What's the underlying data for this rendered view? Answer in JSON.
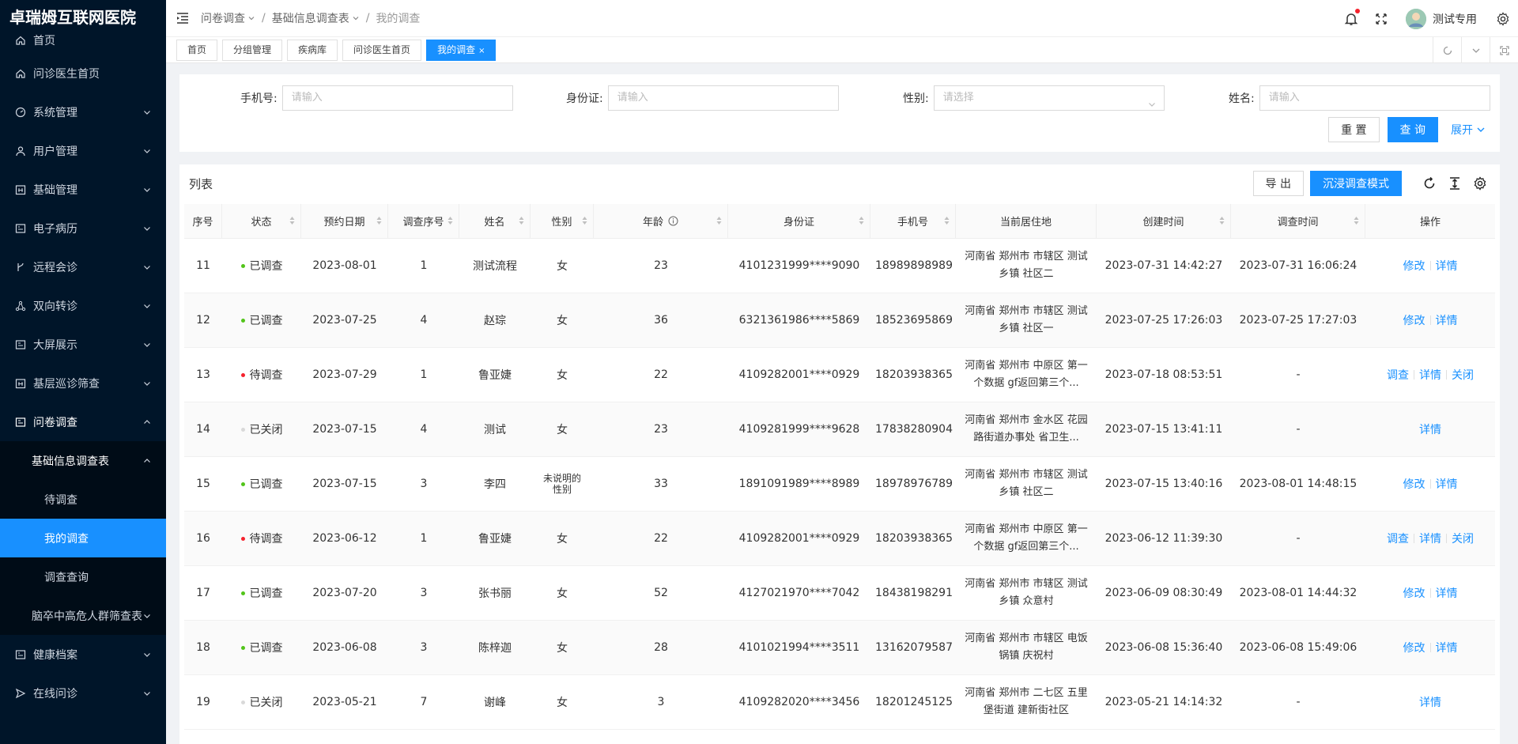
{
  "app": {
    "title": "卓瑞姆互联网医院"
  },
  "sidebar": {
    "items": [
      {
        "label": "首页",
        "icon": "home-icon",
        "arrow": false
      },
      {
        "label": "问诊医生首页",
        "icon": "home-icon",
        "arrow": false
      },
      {
        "label": "系统管理",
        "icon": "dashboard-icon",
        "arrow": true
      },
      {
        "label": "用户管理",
        "icon": "user-icon",
        "arrow": true
      },
      {
        "label": "基础管理",
        "icon": "calendar-icon",
        "arrow": true
      },
      {
        "label": "电子病历",
        "icon": "record-icon",
        "arrow": true
      },
      {
        "label": "远程会诊",
        "icon": "branch-icon",
        "arrow": true
      },
      {
        "label": "双向转诊",
        "icon": "share-icon",
        "arrow": true
      },
      {
        "label": "大屏展示",
        "icon": "screen-icon",
        "arrow": true
      },
      {
        "label": "基层巡诊筛查",
        "icon": "calendar-icon",
        "arrow": true
      },
      {
        "label": "问卷调查",
        "icon": "form-icon",
        "arrow": true,
        "open": true
      },
      {
        "label": "基础信息调查表",
        "arrow": true,
        "open": true,
        "level": 1
      },
      {
        "label": "待调查",
        "level": 2
      },
      {
        "label": "我的调查",
        "level": 2,
        "active": true
      },
      {
        "label": "调查查询",
        "level": 2
      },
      {
        "label": "脑卒中高危人群筛查表",
        "arrow": true,
        "level": 1
      },
      {
        "label": "健康档案",
        "icon": "record-icon",
        "arrow": true
      },
      {
        "label": "在线问诊",
        "icon": "send-icon",
        "arrow": true
      }
    ]
  },
  "header": {
    "breadcrumb": [
      "问卷调查",
      "基础信息调查表",
      "我的调查"
    ],
    "user": "测试专用"
  },
  "tabs": [
    {
      "label": "首页"
    },
    {
      "label": "分组管理"
    },
    {
      "label": "疾病库"
    },
    {
      "label": "问诊医生首页"
    },
    {
      "label": "我的调查",
      "active": true,
      "close": "×"
    }
  ],
  "search": {
    "phone_label": "手机号:",
    "phone_placeholder": "请输入",
    "idcard_label": "身份证:",
    "idcard_placeholder": "请输入",
    "gender_label": "性别:",
    "gender_placeholder": "请选择",
    "name_label": "姓名:",
    "name_placeholder": "请输入",
    "reset": "重 置",
    "query": "查 询",
    "expand": "展开"
  },
  "list": {
    "title": "列表",
    "export": "导 出",
    "immersive": "沉浸调查模式",
    "columns": [
      "序号",
      "状态",
      "预约日期",
      "调查序号",
      "姓名",
      "性别",
      "年龄",
      "身份证",
      "手机号",
      "当前居住地",
      "创建时间",
      "调查时间",
      "操作"
    ],
    "rows": [
      {
        "no": "11",
        "status": "已调查",
        "status_color": "#52c41a",
        "date": "2023-08-01",
        "seq": "1",
        "name": "测试流程",
        "gender": "女",
        "age": "23",
        "id": "4101231999****9090",
        "phone": "18989898989",
        "addr": "河南省 郑州市 市辖区 测试乡镇 社区二",
        "created": "2023-07-31 14:42:27",
        "surveyed": "2023-07-31 16:06:24",
        "ops": [
          "修改",
          "详情"
        ]
      },
      {
        "no": "12",
        "status": "已调查",
        "status_color": "#52c41a",
        "date": "2023-07-25",
        "seq": "4",
        "name": "赵琮",
        "gender": "女",
        "age": "36",
        "id": "6321361986****5869",
        "phone": "18523695869",
        "addr": "河南省 郑州市 市辖区 测试乡镇 社区一",
        "created": "2023-07-25 17:26:03",
        "surveyed": "2023-07-25 17:27:03",
        "ops": [
          "修改",
          "详情"
        ]
      },
      {
        "no": "13",
        "status": "待调查",
        "status_color": "#f5222d",
        "date": "2023-07-29",
        "seq": "1",
        "name": "鲁亚婕",
        "gender": "女",
        "age": "22",
        "id": "4109282001****0929",
        "phone": "18203938365",
        "addr": "河南省 郑州市 中原区 第一个数据 gf返回第三个...",
        "created": "2023-07-18 08:53:51",
        "surveyed": "-",
        "ops": [
          "调查",
          "详情",
          "关闭"
        ]
      },
      {
        "no": "14",
        "status": "已关闭",
        "status_color": "#d9d9d9",
        "date": "2023-07-15",
        "seq": "4",
        "name": "测试",
        "gender": "女",
        "age": "23",
        "id": "4109281999****9628",
        "phone": "17838280904",
        "addr": "河南省 郑州市 金水区 花园路街道办事处 省卫生...",
        "created": "2023-07-15 13:41:11",
        "surveyed": "-",
        "ops": [
          "详情"
        ]
      },
      {
        "no": "15",
        "status": "已调查",
        "status_color": "#52c41a",
        "date": "2023-07-15",
        "seq": "3",
        "name": "李四",
        "gender": "未说明的性别",
        "age": "33",
        "id": "1891091989****8989",
        "phone": "18978976789",
        "addr": "河南省 郑州市 市辖区 测试乡镇 社区二",
        "created": "2023-07-15 13:40:16",
        "surveyed": "2023-08-01 14:48:15",
        "ops": [
          "修改",
          "详情"
        ]
      },
      {
        "no": "16",
        "status": "待调查",
        "status_color": "#f5222d",
        "date": "2023-06-12",
        "seq": "1",
        "name": "鲁亚婕",
        "gender": "女",
        "age": "22",
        "id": "4109282001****0929",
        "phone": "18203938365",
        "addr": "河南省 郑州市 中原区 第一个数据 gf返回第三个...",
        "created": "2023-06-12 11:39:30",
        "surveyed": "-",
        "ops": [
          "调查",
          "详情",
          "关闭"
        ]
      },
      {
        "no": "17",
        "status": "已调查",
        "status_color": "#52c41a",
        "date": "2023-07-20",
        "seq": "3",
        "name": "张书丽",
        "gender": "女",
        "age": "52",
        "id": "4127021970****7042",
        "phone": "18438198291",
        "addr": "河南省 郑州市 市辖区 测试乡镇 众意村",
        "created": "2023-06-09 08:30:49",
        "surveyed": "2023-08-01 14:44:32",
        "ops": [
          "修改",
          "详情"
        ]
      },
      {
        "no": "18",
        "status": "已调查",
        "status_color": "#52c41a",
        "date": "2023-06-08",
        "seq": "3",
        "name": "陈梓迦",
        "gender": "女",
        "age": "28",
        "id": "4101021994****3511",
        "phone": "13162079587",
        "addr": "河南省 郑州市 市辖区 电饭锅镇 庆祝村",
        "created": "2023-06-08 15:36:40",
        "surveyed": "2023-06-08 15:49:06",
        "ops": [
          "修改",
          "详情"
        ]
      },
      {
        "no": "19",
        "status": "已关闭",
        "status_color": "#d9d9d9",
        "date": "2023-05-21",
        "seq": "7",
        "name": "谢峰",
        "gender": "女",
        "age": "3",
        "id": "4109282020****3456",
        "phone": "18201245125",
        "addr": "河南省 郑州市 二七区 五里堡街道 建新街社区",
        "created": "2023-05-21 14:14:32",
        "surveyed": "-",
        "ops": [
          "详情"
        ]
      }
    ]
  },
  "colors": {
    "primary": "#1890ff",
    "sidebar_bg": "#001529",
    "success": "#52c41a",
    "danger": "#f5222d"
  }
}
